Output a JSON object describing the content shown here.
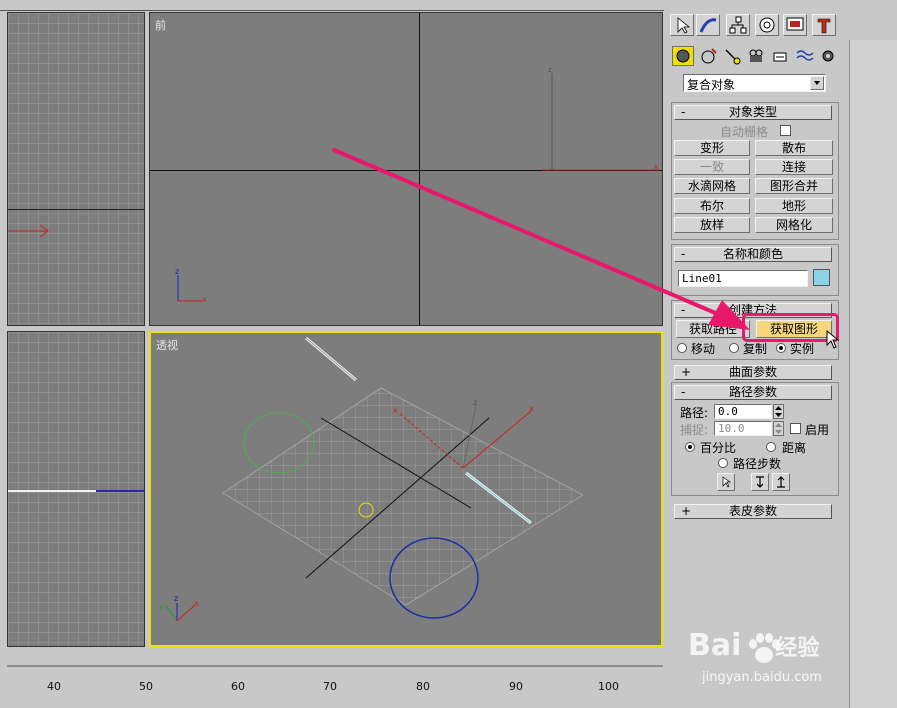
{
  "viewports": {
    "front_label": "前",
    "perspective_label": "透视"
  },
  "panel": {
    "category_dropdown": "复合对象",
    "object_type": {
      "title": "对象类型",
      "auto_grid": "自动栅格",
      "buttons": [
        "变形",
        "散布",
        "一致",
        "连接",
        "水滴网格",
        "图形合并",
        "布尔",
        "地形",
        "放样",
        "网格化"
      ]
    },
    "name_color": {
      "title": "名称和颜色",
      "name_value": "Line01",
      "swatch_color": "#8cd2e6"
    },
    "creation_method": {
      "title": "创建方法",
      "get_path": "获取路径",
      "get_shape": "获取图形",
      "radio_move": "移动",
      "radio_copy": "复制",
      "radio_instance": "实例"
    },
    "surface_params": {
      "title": "曲面参数"
    },
    "path_params": {
      "title": "路径参数",
      "path_label": "路径:",
      "path_value": "0.0",
      "snap_label": "捕捉:",
      "snap_value": "10.0",
      "enable_label": "启用",
      "percent_label": "百分比",
      "distance_label": "距离",
      "path_steps_label": "路径步数"
    },
    "skin_params": {
      "title": "表皮参数"
    }
  },
  "timeline": {
    "ticks": [
      "40",
      "50",
      "60",
      "70",
      "80",
      "90",
      "100"
    ]
  },
  "watermark": {
    "brand": "Bai",
    "brand_cn": "经验",
    "url": "jingyan.baidu.com"
  },
  "colors": {
    "highlight": "#e8186a",
    "active_viewport": "#f0e000",
    "shape_button": "#f5d67a"
  }
}
